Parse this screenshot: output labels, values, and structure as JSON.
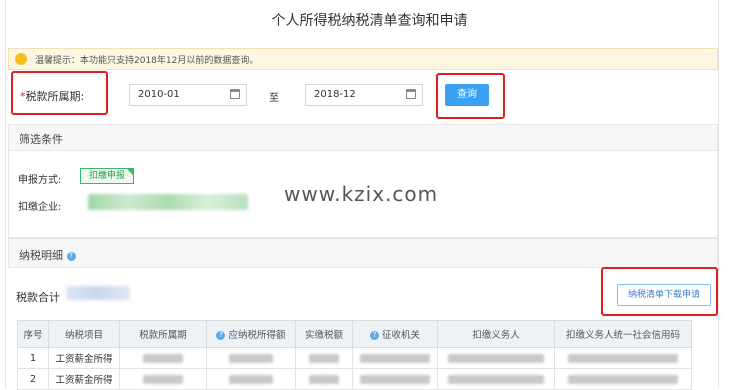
{
  "header": {
    "title": "个人所得税纳税清单查询和申请"
  },
  "tip": {
    "text": "温馨提示：本功能只支持2018年12月以前的数据查询。"
  },
  "query": {
    "period_label": "税款所属期:",
    "required_mark": "*",
    "start_date": "2010-01",
    "to_label": "至",
    "end_date": "2018-12",
    "query_button": "查询"
  },
  "filter": {
    "title": "筛选条件",
    "report_method_label": "申报方式:",
    "report_method_tag": "扣缴申报",
    "withholder_label": "扣缴企业:"
  },
  "watermark": "www.kzix.com",
  "details": {
    "title": "纳税明细",
    "total_label": "税款合计",
    "download_button": "纳税清单下载申请",
    "columns": [
      "序号",
      "纳税项目",
      "税款所属期",
      "应纳税所得额",
      "实缴税额",
      "征收机关",
      "扣缴义务人",
      "扣缴义务人统一社会信用码"
    ],
    "rows": [
      {
        "index": "1",
        "item": "工资薪金所得"
      },
      {
        "index": "2",
        "item": "工资薪金所得"
      }
    ]
  },
  "colors": {
    "accent": "#3aa0f2",
    "highlight": "#e02020",
    "tag": "#3db66a"
  }
}
